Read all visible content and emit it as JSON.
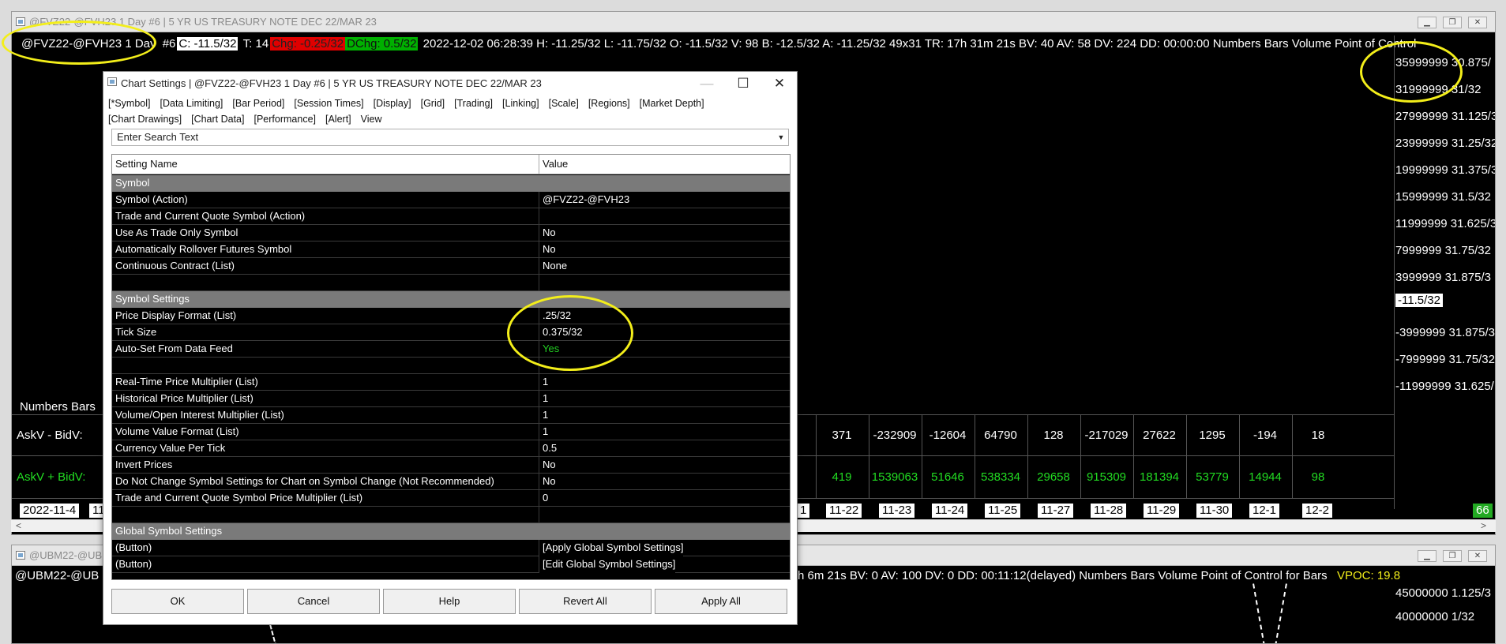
{
  "main_window": {
    "title": "@FVZ22-@FVH23  1 Day   #6 | 5 YR US TREASURY NOTE DEC 22/MAR 23",
    "header": {
      "symbol": "@FVZ22-@FVH23  1 Day",
      "chart_num": "#6",
      "close": "C: -11.5/32",
      "trades": "T: 14",
      "chg": "Chg: -0.25/32",
      "dchg": "DChg: 0.5/32",
      "rest": "2022-12-02 06:28:39 H: -11.25/32 L: -11.75/32 O: -11.5/32 V: 98 B: -12.5/32 A: -11.25/32 49x31 TR: 17h 31m 21s BV: 40 AV: 58 DV: 224 DD: 00:00:00 Numbers Bars  Volume Point of Control"
    },
    "price_axis": [
      "35999999 30.875/",
      "31999999 31/32",
      "27999999 31.125/3",
      "23999999 31.25/32",
      "19999999 31.375/3",
      "15999999 31.5/32",
      "11999999 31.625/3",
      "7999999 31.75/32",
      "3999999 31.875/3",
      "-3999999 31.875/3",
      "-7999999 31.75/32",
      "-11999999 31.625/"
    ],
    "current_price": "-11.5/32",
    "numbers_bars_label": "Numbers Bars",
    "askv_bidv_label": "AskV - BidV:",
    "askv_plus_bidv_label": "AskV + BidV:",
    "askv_minus_values": [
      "371",
      "-232909",
      "-12604",
      "64790",
      "128",
      "-217029",
      "27622",
      "1295",
      "-194",
      "18"
    ],
    "askv_plus_values": [
      "419",
      "1539063",
      "51646",
      "538334",
      "29658",
      "915309",
      "181394",
      "53779",
      "14944",
      "98"
    ],
    "dates_left": [
      "2022-11-4",
      "11"
    ],
    "dates_right": [
      "1",
      "11-22",
      "11-23",
      "11-24",
      "11-25",
      "11-27",
      "11-28",
      "11-29",
      "11-30",
      "12-1",
      "12-2"
    ],
    "corner_value": "66"
  },
  "lower_window": {
    "title": "@UBM22-@UBU2",
    "header_left": "@UBM22-@UB",
    "header_right": "h 6m 21s BV: 0 AV: 100 DV: 0 DD: 00:11:12(delayed) Numbers Bars  Volume Point of Control for Bars",
    "vpoc": "VPOC: 19.8",
    "price_axis": [
      "45000000 1.125/3",
      "40000000 1/32"
    ]
  },
  "dialog": {
    "title": "Chart Settings | @FVZ22-@FVH23  1 Day   #6 | 5 YR US TREASURY NOTE DEC 22/MAR 23",
    "tabs": [
      "[*Symbol]",
      "[Data Limiting]",
      "[Bar Period]",
      "[Session Times]",
      "[Display]",
      "[Grid]",
      "[Trading]",
      "[Linking]",
      "[Scale]",
      "[Regions]",
      "[Market Depth]",
      "[Chart Drawings]",
      "[Chart Data]",
      "[Performance]",
      "[Alert]",
      "View"
    ],
    "search_placeholder": "Enter Search Text",
    "col_name": "Setting Name",
    "col_value": "Value",
    "rows": [
      {
        "name": "Symbol",
        "value": "",
        "section": true
      },
      {
        "name": "Symbol (Action)",
        "value": "@FVZ22-@FVH23"
      },
      {
        "name": "Trade and Current Quote Symbol (Action)",
        "value": ""
      },
      {
        "name": "Use As Trade Only Symbol",
        "value": "No"
      },
      {
        "name": "Automatically Rollover Futures Symbol",
        "value": "No"
      },
      {
        "name": "Continuous Contract (List)",
        "value": "None"
      },
      {
        "name": "",
        "value": ""
      },
      {
        "name": "Symbol Settings",
        "value": "",
        "section": true
      },
      {
        "name": "Price Display Format (List)",
        "value": ".25/32"
      },
      {
        "name": "Tick Size",
        "value": "0.375/32"
      },
      {
        "name": "Auto-Set From Data Feed",
        "value": "Yes"
      },
      {
        "name": "",
        "value": ""
      },
      {
        "name": "Real-Time Price Multiplier (List)",
        "value": "1"
      },
      {
        "name": "Historical Price Multiplier (List)",
        "value": "1"
      },
      {
        "name": "Volume/Open Interest Multiplier (List)",
        "value": "1"
      },
      {
        "name": "Volume Value Format (List)",
        "value": "1"
      },
      {
        "name": "Currency Value Per Tick",
        "value": "0.5"
      },
      {
        "name": "Invert Prices",
        "value": "No"
      },
      {
        "name": "Do Not Change Symbol Settings for Chart on Symbol Change (Not Recommended)",
        "value": "No"
      },
      {
        "name": "Trade and Current Quote Symbol Price Multiplier (List)",
        "value": "0"
      },
      {
        "name": "",
        "value": ""
      },
      {
        "name": "Global Symbol Settings",
        "value": "",
        "section": true
      },
      {
        "name": " (Button)",
        "value": "[Apply Global Symbol Settings]"
      },
      {
        "name": " (Button)",
        "value": "[Edit Global Symbol Settings]"
      }
    ],
    "buttons": {
      "ok": "OK",
      "cancel": "Cancel",
      "help": "Help",
      "revert": "Revert All",
      "apply": "Apply All"
    },
    "yes_color": "#22cc22"
  },
  "colors": {
    "annotation": "#f3ee1a",
    "section_bg": "#7a7a7a",
    "green_text": "#22dd22"
  }
}
